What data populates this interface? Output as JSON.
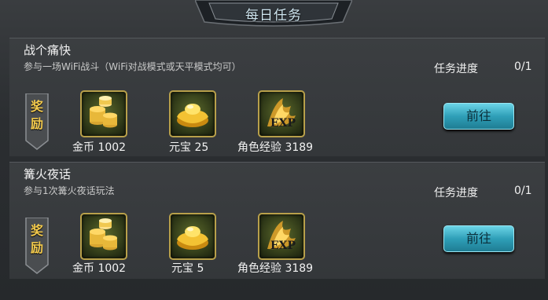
{
  "header": {
    "title": "每日任务"
  },
  "tasks": [
    {
      "name": "战个痛快",
      "description": "参与一场WiFi战斗（WiFi对战模式或天平模式均可）",
      "progress_label": "任务进度",
      "progress_value": "0/1",
      "reward_tag": [
        "奖",
        "励"
      ],
      "rewards": [
        {
          "icon": "gold-coins-icon",
          "label": "金币 1002"
        },
        {
          "icon": "yuanbao-ingot-icon",
          "label": "元宝 25"
        },
        {
          "icon": "exp-icon",
          "label": "角色经验 3189"
        }
      ],
      "go_label": "前往"
    },
    {
      "name": "篝火夜话",
      "description": "参与1次篝火夜话玩法",
      "progress_label": "任务进度",
      "progress_value": "0/1",
      "reward_tag": [
        "奖",
        "励"
      ],
      "rewards": [
        {
          "icon": "gold-coins-icon",
          "label": "金币 1002"
        },
        {
          "icon": "yuanbao-ingot-icon",
          "label": "元宝 5"
        },
        {
          "icon": "exp-icon",
          "label": "角色经验 3189"
        }
      ],
      "go_label": "前往"
    }
  ],
  "colors": {
    "accent_button": "#2f9fb8",
    "reward_text": "#f2c94c",
    "item_frame": "#b8a04a"
  }
}
